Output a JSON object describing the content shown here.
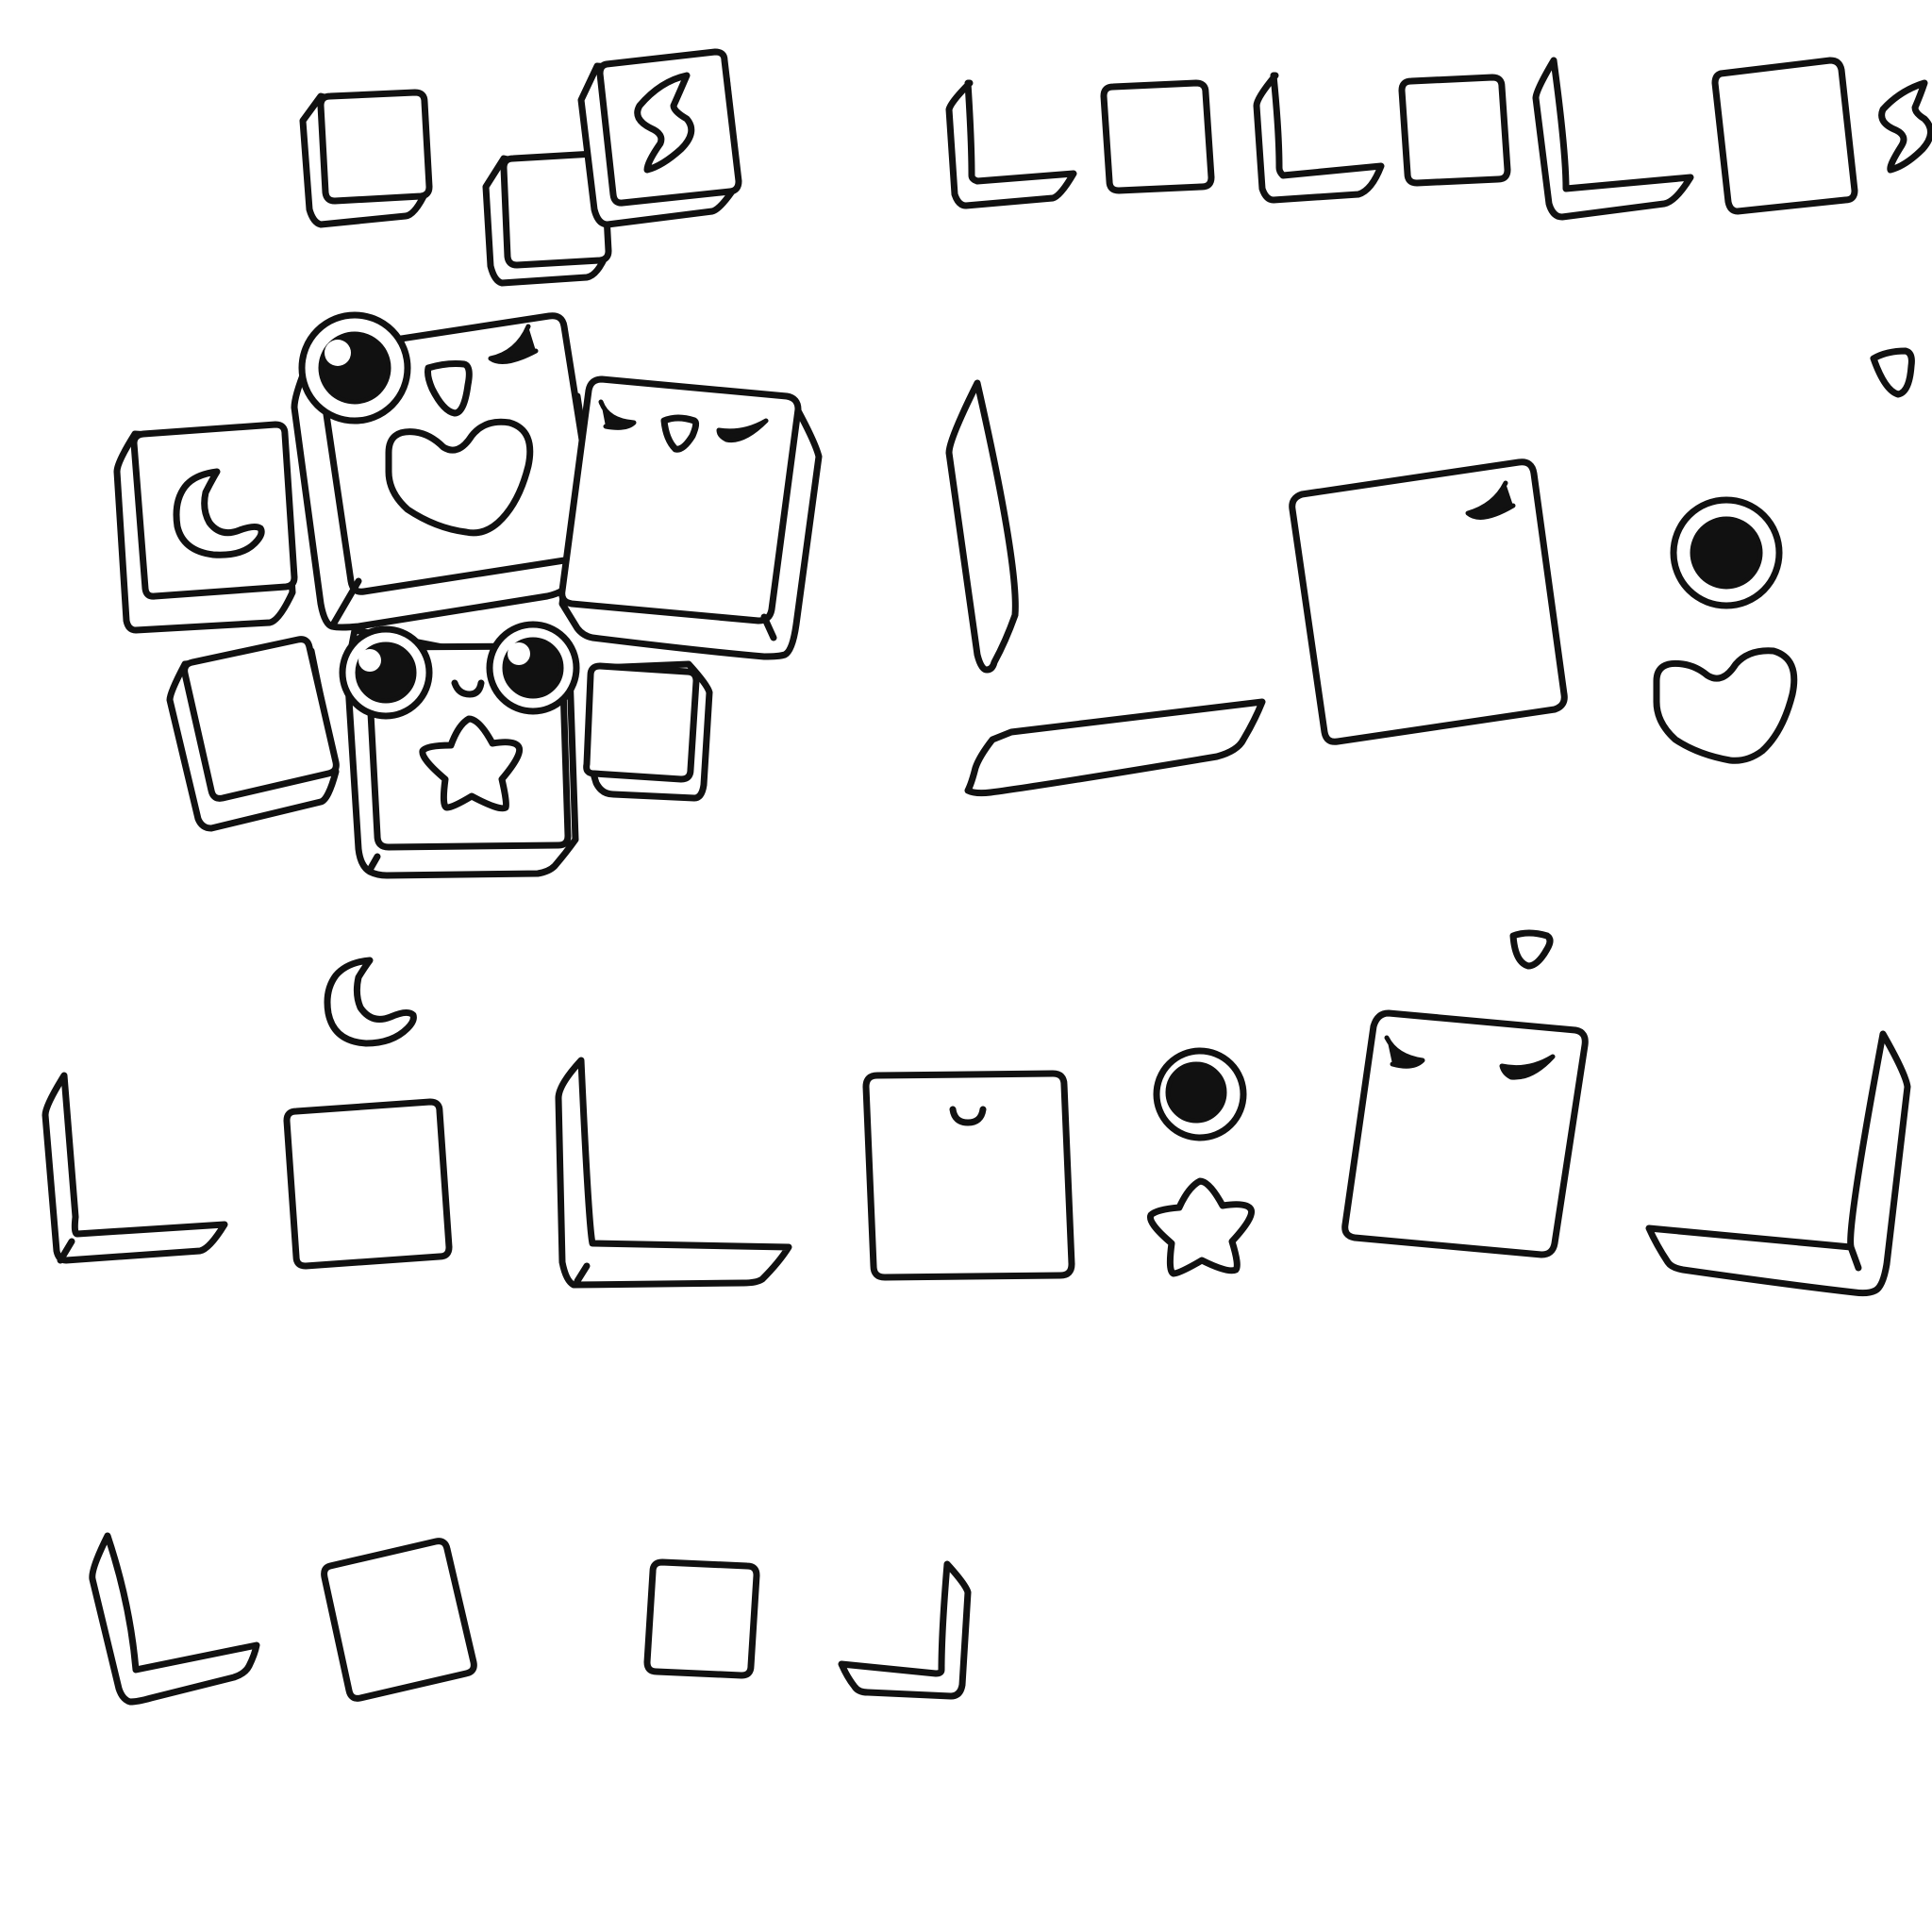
{
  "sheet": {
    "kind": "sprite-sheet",
    "background": "#ffffff",
    "line_color": "#111111",
    "fill_color": "#ffffff",
    "sprites": [
      "small-block",
      "lightning-block",
      "main-face-block",
      "moon-block",
      "sleepy-block",
      "star-face-block",
      "block-face-panel",
      "block-side-panel",
      "wink-eye",
      "round-eye",
      "heart-mouth",
      "star-mark",
      "moon-mark",
      "raindrop-mark",
      "lightning-mark"
    ]
  }
}
